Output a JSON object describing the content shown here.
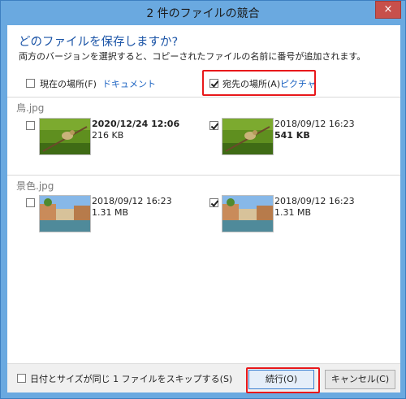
{
  "window": {
    "title": "2 件のファイルの競合",
    "close_label": "×"
  },
  "dialog": {
    "heading": "どのファイルを保存しますか?",
    "description": "両方のバージョンを選択すると、コピーされたファイルの名前に番号が追加されます。"
  },
  "columns": {
    "current": {
      "label": "現在の場所(F)",
      "link": "ドキュメント",
      "checked": false
    },
    "destination": {
      "label": "宛先の場所(A)",
      "link": "ピクチャ",
      "checked": true
    }
  },
  "files": [
    {
      "name": "鳥.jpg",
      "left": {
        "date": "2020/12/24 12:06",
        "size": "216 KB",
        "checked": false,
        "date_bold": true,
        "size_bold": false
      },
      "right": {
        "date": "2018/09/12 16:23",
        "size": "541 KB",
        "checked": true,
        "date_bold": false,
        "size_bold": true
      },
      "thumbnail_icon": "bird-photo-icon"
    },
    {
      "name": "景色.jpg",
      "left": {
        "date": "2018/09/12 16:23",
        "size": "1.31 MB",
        "checked": false
      },
      "right": {
        "date": "2018/09/12 16:23",
        "size": "1.31 MB",
        "checked": true
      },
      "thumbnail_icon": "canal-photo-icon"
    }
  ],
  "footer": {
    "skip_label": "日付とサイズが同じ 1 ファイルをスキップする(S)",
    "skip_checked": false,
    "continue_label": "続行(O)",
    "cancel_label": "キャンセル(C)"
  },
  "colors": {
    "accent": "#1c55a7",
    "highlight": "#e8181b",
    "title_bar": "#6aa9e0"
  }
}
